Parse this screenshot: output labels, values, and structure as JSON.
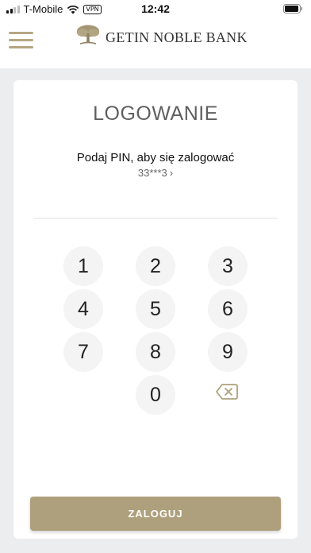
{
  "status_bar": {
    "carrier": "T-Mobile",
    "vpn": "VPN",
    "time": "12:42"
  },
  "header": {
    "logo_text": "GETIN NOBLE BANK"
  },
  "login": {
    "title": "LOGOWANIE",
    "prompt": "Podaj PIN, aby się zalogować",
    "account_masked": "33***3",
    "account_chevron": "›",
    "submit_label": "ZALOGUJ"
  },
  "keypad": {
    "keys": [
      "1",
      "2",
      "3",
      "4",
      "5",
      "6",
      "7",
      "8",
      "9",
      "0"
    ],
    "backspace_icon": "backspace-icon"
  },
  "colors": {
    "accent": "#aea07c",
    "menu_icon": "#b5a683",
    "background": "#ecedef",
    "key_bg": "#f4f4f4"
  }
}
